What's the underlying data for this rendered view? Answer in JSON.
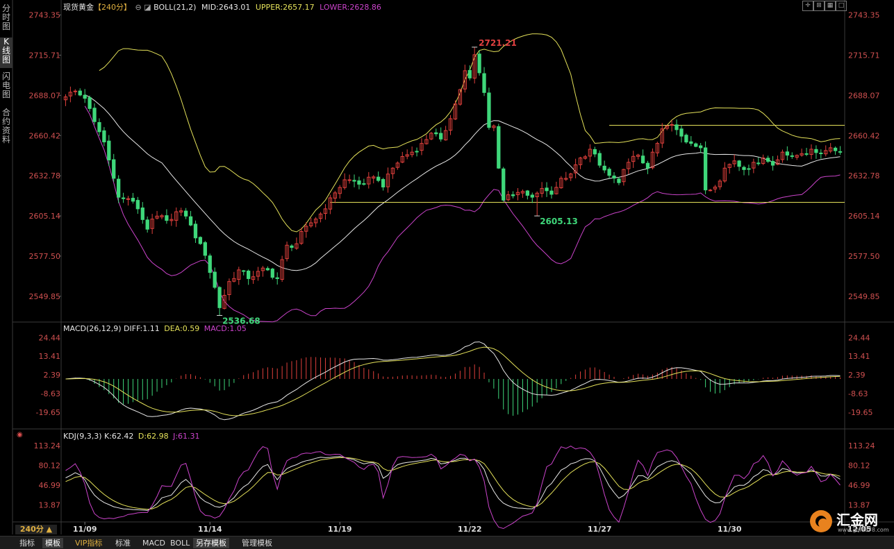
{
  "header": {
    "instrument": "现货黄金",
    "period_tag": "【240分】",
    "boll": "BOLL(21,2)",
    "mid": "MID:2643.01",
    "upper": "UPPER:2657.17",
    "lower": "LOWER:2628.86"
  },
  "macd_header": {
    "name": "MACD(26,12,9)",
    "diff": "DIFF:1.11",
    "dea": "DEA:0.59",
    "macd": "MACD:1.05"
  },
  "kdj_header": {
    "name": "KDJ(9,3,3)",
    "k": "K:62.42",
    "d": "D:62.98",
    "j": "J:61.31"
  },
  "side_tabs": [
    "分时图",
    "K线图",
    "闪电图",
    "合约资料"
  ],
  "bottom_tabs": [
    "指标",
    "模板",
    "VIP指标",
    "标准",
    "MACD",
    "BOLL",
    "另存模板",
    "管理模板"
  ],
  "period_button": "240分 ▲",
  "logo_text": "汇金网",
  "logo_url": "www.gold678.com",
  "colors": {
    "up": "#e0403c",
    "down": "#3fd77a",
    "upper": "#e5e25a",
    "mid": "#e8e8e8",
    "lower": "#cc44cc",
    "diff": "#e8e8e8",
    "dea": "#e5e25a",
    "j": "#cc44cc"
  },
  "chart_data": {
    "type": "candlestick",
    "price_axis_ticks": [
      "2743.35",
      "2715.71",
      "2688.07",
      "2660.42",
      "2632.78",
      "2605.14",
      "2577.50",
      "2549.85"
    ],
    "price_range": [
      2535,
      2746
    ],
    "x_tick_labels": [
      "11/09",
      "11/14",
      "11/19",
      "11/22",
      "11/27",
      "11/30",
      "12/05"
    ],
    "x_tick_index": [
      4,
      30,
      57,
      84,
      111,
      138,
      165
    ],
    "annotations": [
      {
        "text": "2721.21",
        "index": 85,
        "price": 2721.21,
        "position": "right"
      },
      {
        "text": "2605.13",
        "index": 98,
        "price": 2605.13,
        "position": "below"
      },
      {
        "text": "2536.68",
        "index": 32,
        "price": 2536.68,
        "position": "below"
      }
    ],
    "horizontal_lines": [
      {
        "price": 2667.5,
        "from_index": 113
      },
      {
        "price": 2614.5,
        "from_index": 55
      }
    ],
    "anchors": [
      {
        "i": 0,
        "c": 2687
      },
      {
        "i": 2,
        "c": 2691
      },
      {
        "i": 4,
        "c": 2686
      },
      {
        "i": 5,
        "c": 2679
      },
      {
        "i": 6,
        "c": 2670
      },
      {
        "i": 8,
        "c": 2656
      },
      {
        "i": 10,
        "c": 2631
      },
      {
        "i": 11,
        "c": 2618
      },
      {
        "i": 12,
        "c": 2617
      },
      {
        "i": 13,
        "c": 2617
      },
      {
        "i": 15,
        "c": 2610
      },
      {
        "i": 17,
        "c": 2596
      },
      {
        "i": 19,
        "c": 2605
      },
      {
        "i": 21,
        "c": 2602
      },
      {
        "i": 23,
        "c": 2608
      },
      {
        "i": 25,
        "c": 2605
      },
      {
        "i": 27,
        "c": 2590
      },
      {
        "i": 29,
        "c": 2578
      },
      {
        "i": 31,
        "c": 2556
      },
      {
        "i": 32,
        "c": 2542
      },
      {
        "i": 34,
        "c": 2560
      },
      {
        "i": 36,
        "c": 2568
      },
      {
        "i": 38,
        "c": 2562
      },
      {
        "i": 40,
        "c": 2567
      },
      {
        "i": 42,
        "c": 2568
      },
      {
        "i": 44,
        "c": 2562
      },
      {
        "i": 46,
        "c": 2585
      },
      {
        "i": 48,
        "c": 2586
      },
      {
        "i": 50,
        "c": 2598
      },
      {
        "i": 52,
        "c": 2603
      },
      {
        "i": 54,
        "c": 2610
      },
      {
        "i": 56,
        "c": 2621
      },
      {
        "i": 58,
        "c": 2630
      },
      {
        "i": 60,
        "c": 2629
      },
      {
        "i": 62,
        "c": 2627
      },
      {
        "i": 64,
        "c": 2632
      },
      {
        "i": 66,
        "c": 2625
      },
      {
        "i": 68,
        "c": 2638
      },
      {
        "i": 70,
        "c": 2646
      },
      {
        "i": 72,
        "c": 2649
      },
      {
        "i": 74,
        "c": 2655
      },
      {
        "i": 76,
        "c": 2662
      },
      {
        "i": 78,
        "c": 2658
      },
      {
        "i": 80,
        "c": 2672
      },
      {
        "i": 82,
        "c": 2692
      },
      {
        "i": 83,
        "c": 2705
      },
      {
        "i": 84,
        "c": 2700
      },
      {
        "i": 85,
        "c": 2716
      },
      {
        "i": 87,
        "c": 2690
      },
      {
        "i": 88,
        "c": 2666
      },
      {
        "i": 89,
        "c": 2667
      },
      {
        "i": 90,
        "c": 2638
      },
      {
        "i": 91,
        "c": 2616
      },
      {
        "i": 93,
        "c": 2619
      },
      {
        "i": 95,
        "c": 2622
      },
      {
        "i": 97,
        "c": 2618
      },
      {
        "i": 99,
        "c": 2624
      },
      {
        "i": 101,
        "c": 2620
      },
      {
        "i": 103,
        "c": 2631
      },
      {
        "i": 105,
        "c": 2634
      },
      {
        "i": 107,
        "c": 2645
      },
      {
        "i": 109,
        "c": 2651
      },
      {
        "i": 111,
        "c": 2640
      },
      {
        "i": 113,
        "c": 2633
      },
      {
        "i": 115,
        "c": 2628
      },
      {
        "i": 117,
        "c": 2642
      },
      {
        "i": 119,
        "c": 2647
      },
      {
        "i": 121,
        "c": 2638
      },
      {
        "i": 123,
        "c": 2655
      },
      {
        "i": 124,
        "c": 2665
      },
      {
        "i": 126,
        "c": 2668
      },
      {
        "i": 128,
        "c": 2660
      },
      {
        "i": 130,
        "c": 2655
      },
      {
        "i": 132,
        "c": 2652
      },
      {
        "i": 133,
        "c": 2623
      },
      {
        "i": 135,
        "c": 2625
      },
      {
        "i": 137,
        "c": 2638
      },
      {
        "i": 139,
        "c": 2643
      },
      {
        "i": 141,
        "c": 2637
      },
      {
        "i": 143,
        "c": 2642
      },
      {
        "i": 145,
        "c": 2645
      },
      {
        "i": 147,
        "c": 2640
      },
      {
        "i": 149,
        "c": 2649
      },
      {
        "i": 151,
        "c": 2646
      },
      {
        "i": 153,
        "c": 2648
      },
      {
        "i": 155,
        "c": 2651
      },
      {
        "i": 157,
        "c": 2648
      },
      {
        "i": 159,
        "c": 2652
      },
      {
        "i": 160,
        "c": 2650
      }
    ],
    "macd": {
      "ticks": [
        "24.44",
        "13.41",
        "2.39",
        "-8.63",
        "-19.65"
      ],
      "range": [
        -27,
        27
      ]
    },
    "kdj": {
      "ticks": [
        "113.24",
        "80.12",
        "46.99",
        "13.87"
      ],
      "range": [
        -10,
        125
      ]
    }
  }
}
